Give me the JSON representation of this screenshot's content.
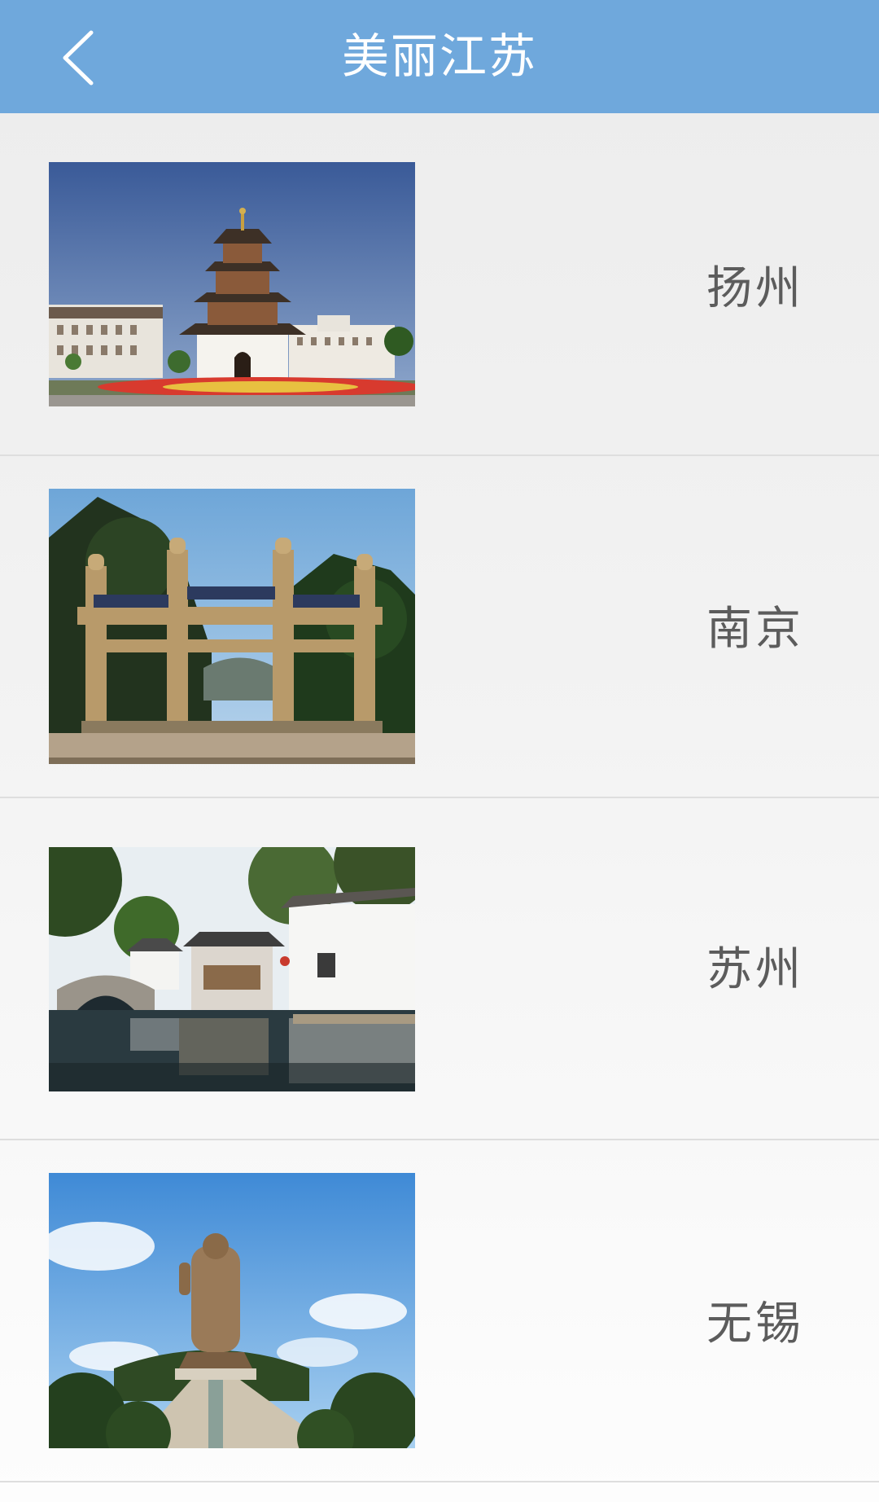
{
  "header": {
    "title": "美丽江苏",
    "back_icon": "chevron-left-icon",
    "background": "#6fa8dc"
  },
  "cities": [
    {
      "name": "扬州",
      "image": "yangzhou-pagoda-photo"
    },
    {
      "name": "南京",
      "image": "nanjing-memorial-archway-photo"
    },
    {
      "name": "苏州",
      "image": "suzhou-water-town-photo"
    },
    {
      "name": "无锡",
      "image": "wuxi-lingshan-buddha-photo"
    }
  ]
}
